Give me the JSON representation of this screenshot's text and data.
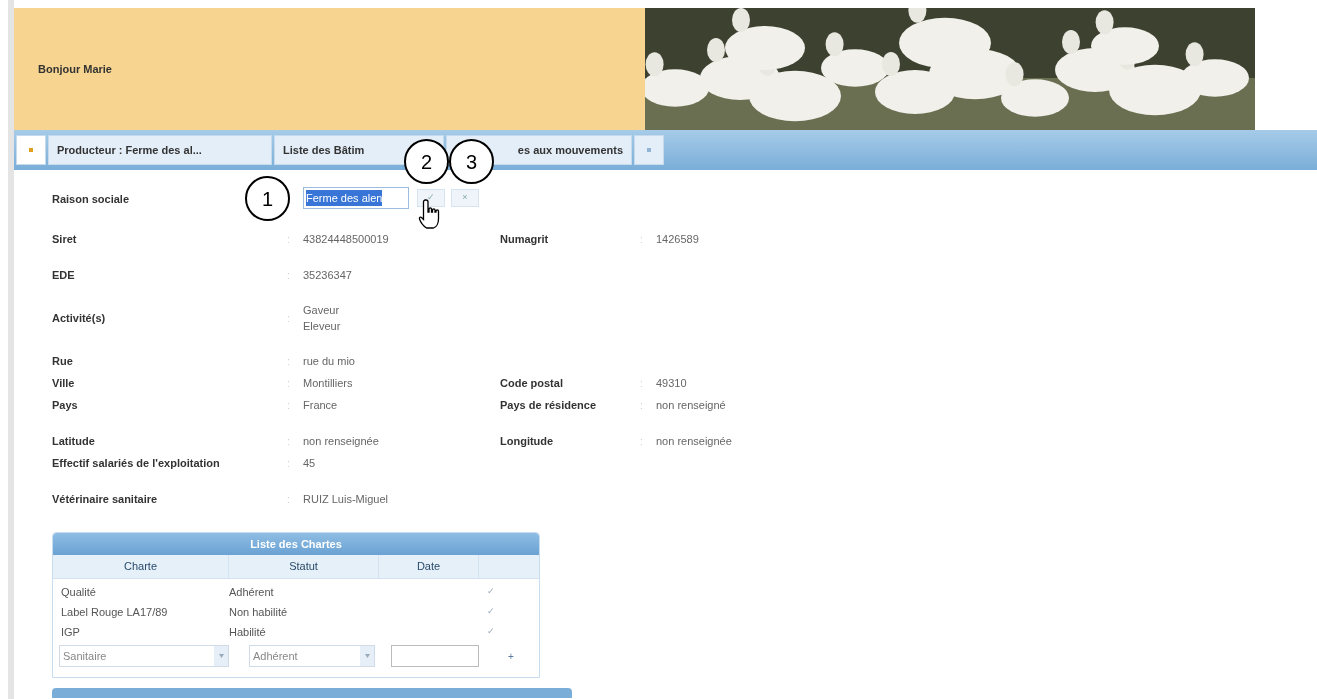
{
  "header": {
    "greeting": "Bonjour Marie"
  },
  "tabs": [
    {
      "kind": "icon",
      "selected": true
    },
    {
      "kind": "text",
      "label": "Producteur : Ferme des al...",
      "selected": false
    },
    {
      "kind": "text",
      "label": "Liste des Bâtim",
      "selected": false
    },
    {
      "kind": "text",
      "label": "es aux mouvements",
      "selected": false
    },
    {
      "kind": "icon",
      "selected": false
    }
  ],
  "raison_sociale": {
    "label": "Raison sociale",
    "value": "Ferme des alen",
    "text_selected": true,
    "confirm": "✓",
    "cancel": "×"
  },
  "separator": ":",
  "groups": [
    [
      {
        "label": "Siret",
        "values": [
          "43824448500019"
        ],
        "right": {
          "label": "Numagrit",
          "values": [
            "1426589"
          ]
        }
      }
    ],
    [
      {
        "label": "EDE",
        "values": [
          "35236347"
        ]
      }
    ],
    [
      {
        "label": "Activité(s)",
        "values": [
          "Gaveur",
          "Eleveur"
        ]
      }
    ],
    [
      {
        "label": "Rue",
        "values": [
          "rue du mio"
        ]
      },
      {
        "label": "Ville",
        "values": [
          "Montilliers"
        ],
        "right": {
          "label": "Code postal",
          "values": [
            "49310"
          ]
        }
      },
      {
        "label": "Pays",
        "values": [
          "France"
        ],
        "right": {
          "label": "Pays de résidence",
          "values": [
            "non renseigné"
          ]
        }
      }
    ],
    [
      {
        "label": "Latitude",
        "values": [
          "non renseignée"
        ],
        "right": {
          "label": "Longitude",
          "values": [
            "non renseignée"
          ]
        }
      },
      {
        "label": "Effectif salariés de l'exploitation",
        "values": [
          "45"
        ]
      }
    ],
    [
      {
        "label": "Vétérinaire sanitaire",
        "values": [
          "RUIZ Luis-Miguel"
        ]
      }
    ]
  ],
  "charts_table": {
    "title": "Liste des Chartes",
    "columns": [
      "Charte",
      "Statut",
      "Date"
    ],
    "rows": [
      {
        "charte": "Qualité",
        "statut": "Adhérent",
        "action": "✓"
      },
      {
        "charte": "Label Rouge LA17/89",
        "statut": "Non habilité",
        "action": "✓"
      },
      {
        "charte": "IGP",
        "statut": "Habilité",
        "action": "✓"
      }
    ],
    "new_row": {
      "charte": "Sanitaire",
      "statut": "Adhérent",
      "add": "+"
    }
  },
  "callouts": [
    "1",
    "2",
    "3"
  ]
}
